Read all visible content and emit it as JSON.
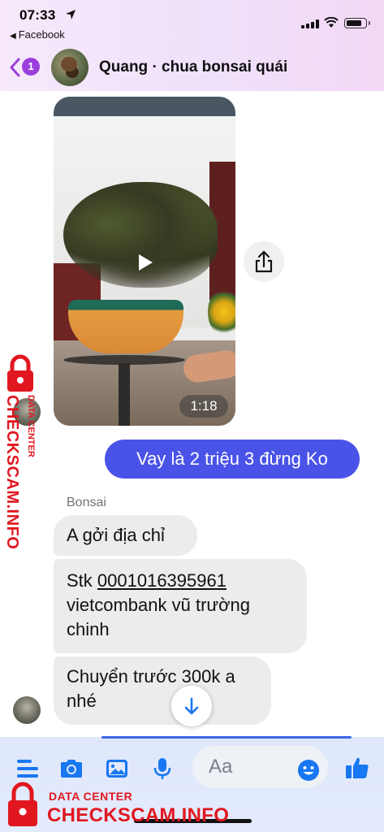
{
  "status_bar": {
    "time": "07:33",
    "back_app": "Facebook"
  },
  "header": {
    "unread_count": "1",
    "title": "Quang · chua bonsai quái"
  },
  "video_message": {
    "duration": "1:18"
  },
  "messages": {
    "outgoing": "Vay là 2 triệu 3 đừng Ko",
    "sender_name": "Bonsai",
    "incoming_1": "A gởi địa chỉ",
    "incoming_2_prefix": "Stk ",
    "incoming_2_account": "0001016395961",
    "incoming_2_rest": " vietcombank vũ trường chinh",
    "incoming_3": "Chuyển trước 300k a nhé"
  },
  "composer": {
    "placeholder": "Aa"
  },
  "watermark": {
    "sub": "DATA CENTER",
    "main": "CHECKSCAM.INFO"
  },
  "colors": {
    "accent": "#4a53e8",
    "badge": "#9b3fdc",
    "icon_blue": "#1877f2",
    "watermark_red": "#e1171f"
  }
}
